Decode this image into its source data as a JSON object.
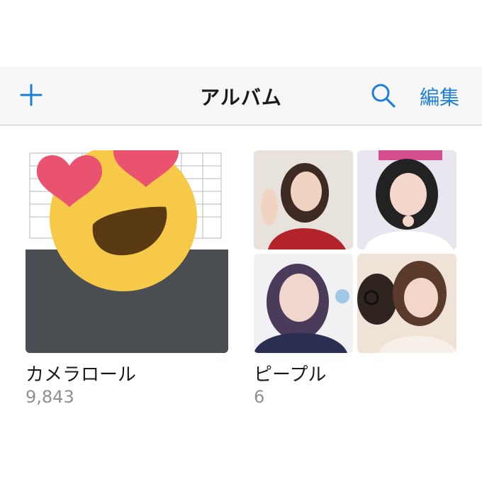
{
  "navbar": {
    "title": "アルバム",
    "edit_label": "編集",
    "add_icon": "plus-icon",
    "search_icon": "magnifier-icon"
  },
  "albums": [
    {
      "name": "カメラロール",
      "count": "9,843"
    },
    {
      "name": "ピープル",
      "count": "6"
    }
  ],
  "colors": {
    "accent": "#1e7fd6",
    "secondary_text": "#8e8e93",
    "navbar_bg": "#f7f7f7",
    "emoji_face": "#f7c948",
    "emoji_heart": "#e9536f",
    "emoji_mouth": "#5a3a12"
  }
}
